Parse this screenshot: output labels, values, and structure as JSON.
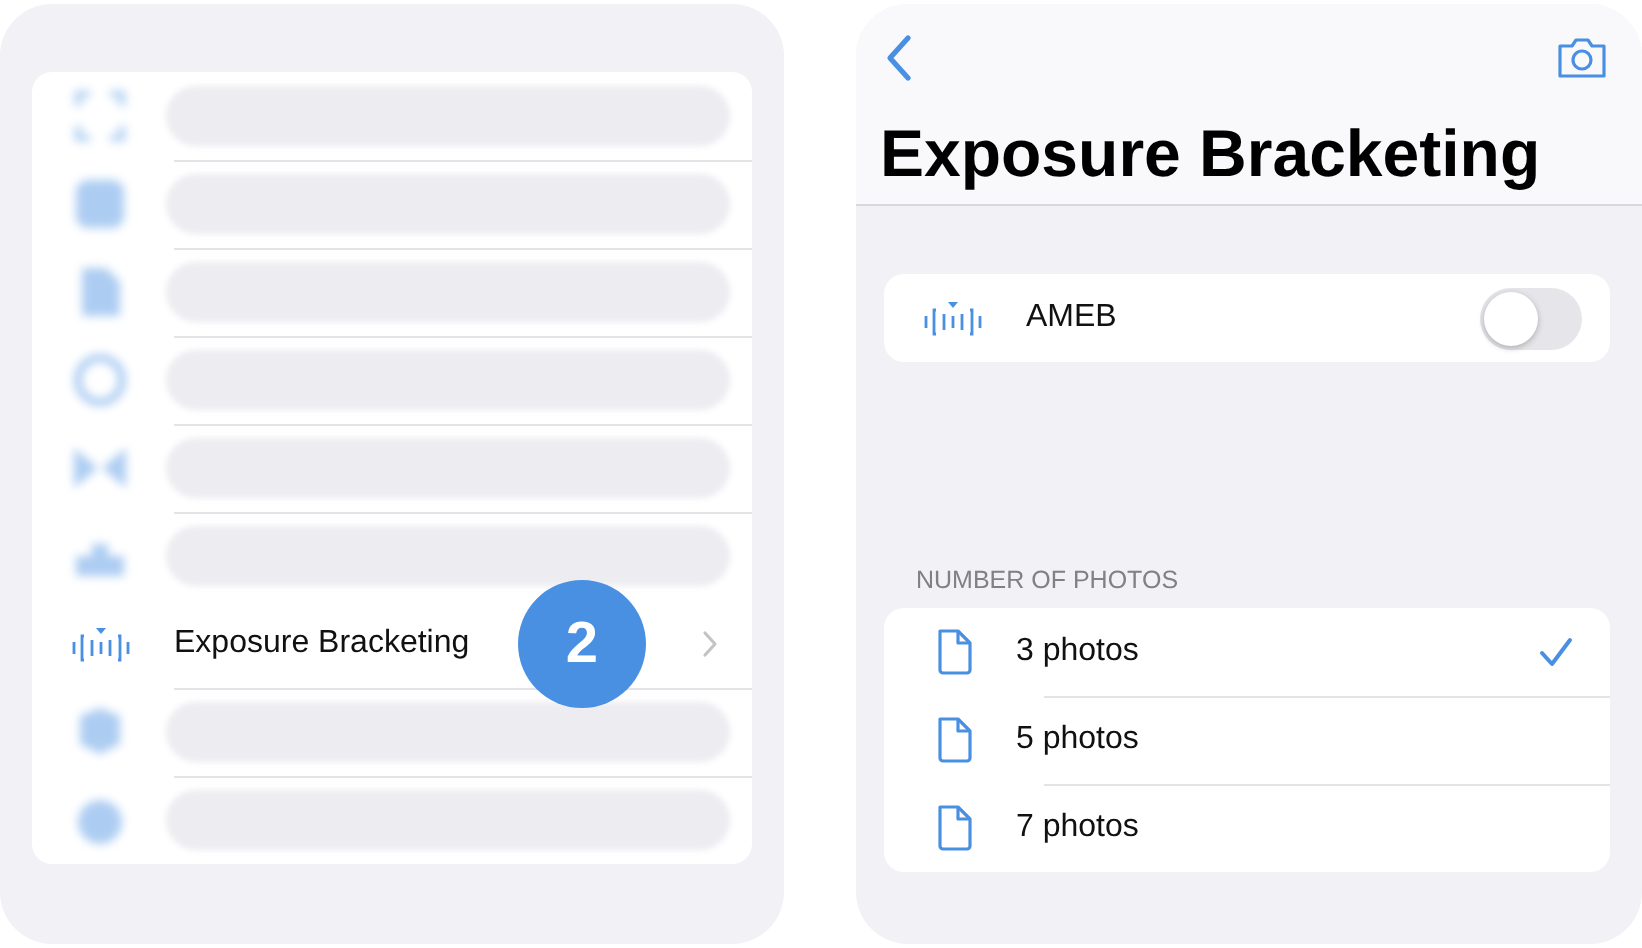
{
  "settings_list": {
    "rows": [
      {
        "kind": "blurred"
      },
      {
        "kind": "blurred"
      },
      {
        "kind": "blurred"
      },
      {
        "kind": "blurred"
      },
      {
        "kind": "blurred"
      },
      {
        "kind": "blurred"
      },
      {
        "kind": "item",
        "label": "Exposure Bracketing",
        "badge": "2"
      },
      {
        "kind": "blurred"
      },
      {
        "kind": "blurred"
      }
    ]
  },
  "detail": {
    "title": "Exposure Bracketing",
    "ameb": {
      "label": "AMEB",
      "on": false
    },
    "section_header": "NUMBER OF PHOTOS",
    "options": [
      {
        "label": "3 photos",
        "selected": true
      },
      {
        "label": "5 photos",
        "selected": false
      },
      {
        "label": "7 photos",
        "selected": false
      }
    ]
  }
}
